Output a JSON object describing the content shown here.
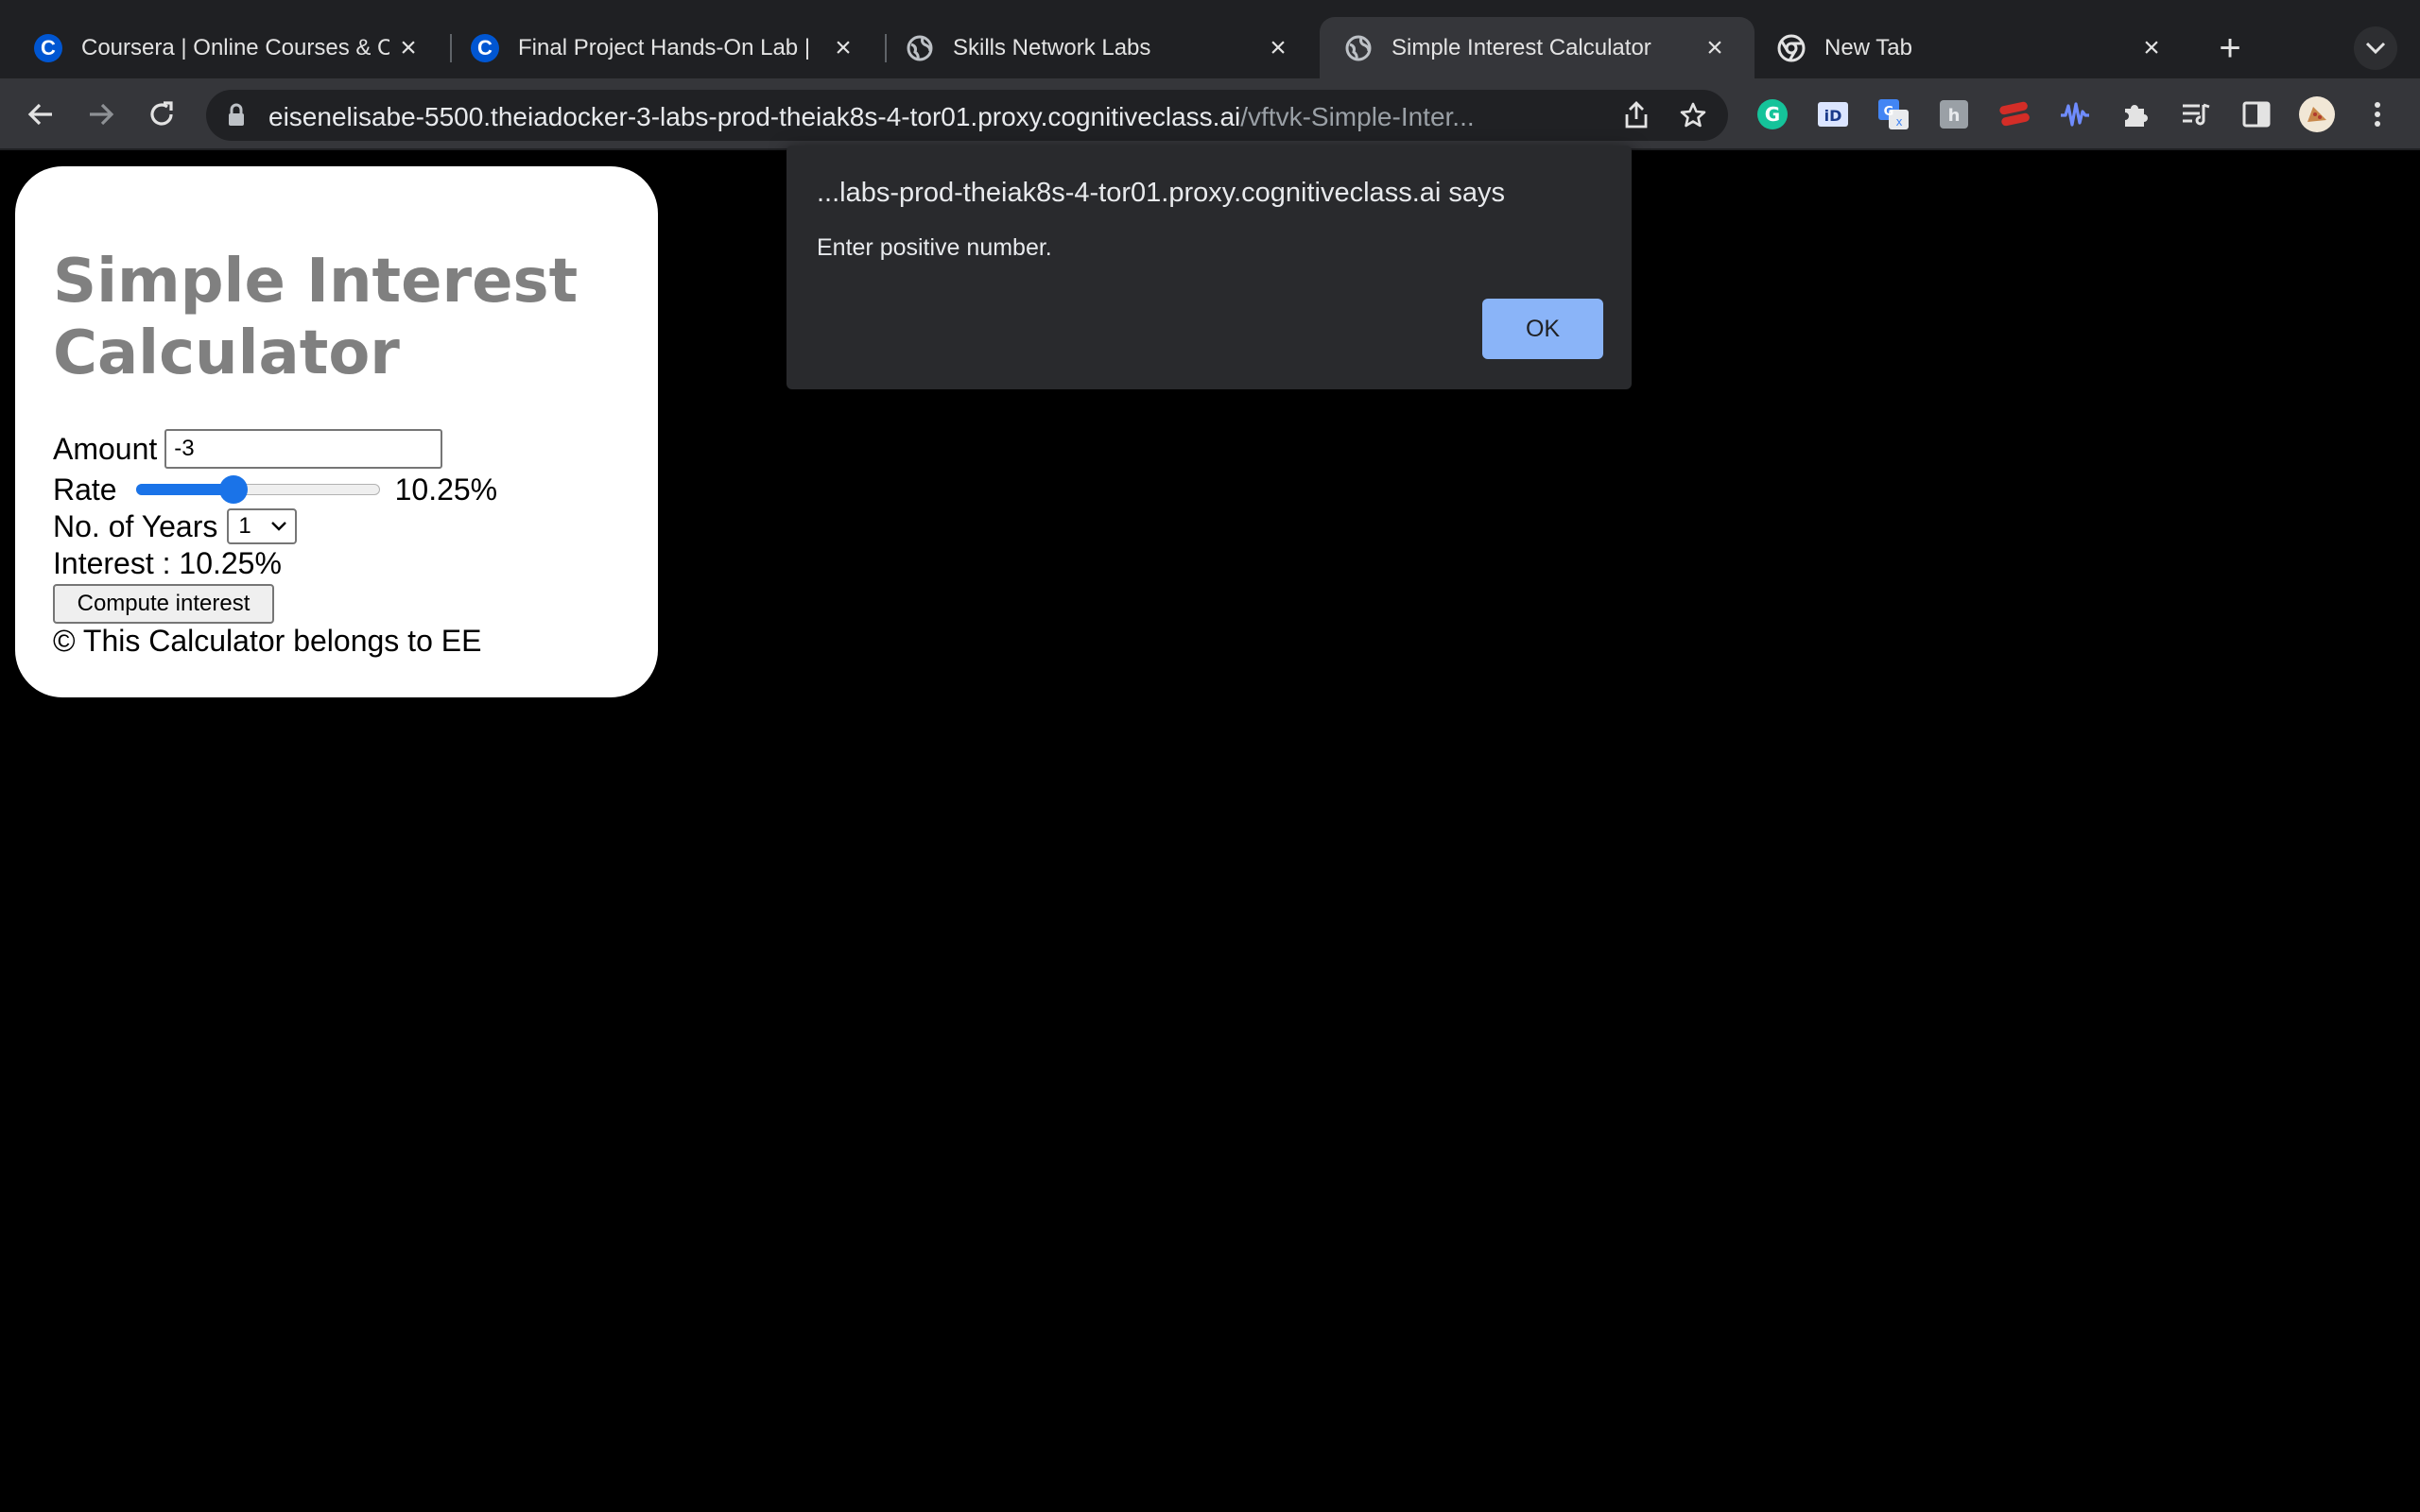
{
  "browser": {
    "tabs": [
      {
        "title": "Coursera | Online Courses & C",
        "icon": "coursera-icon"
      },
      {
        "title": "Final Project Hands-On Lab |",
        "icon": "coursera-icon"
      },
      {
        "title": "Skills Network Labs",
        "icon": "globe-icon"
      },
      {
        "title": "Simple Interest Calculator",
        "icon": "globe-icon",
        "active": true
      },
      {
        "title": "New Tab",
        "icon": "chrome-icon"
      }
    ],
    "url_host": "eisenelisabe-5500.theiadocker-3-labs-prod-theiak8s-4-tor01.proxy.cognitiveclass.ai",
    "url_path": "/vftvk-Simple-Inter...",
    "extensions": [
      "grammarly-icon",
      "id-icon",
      "google-translate-icon",
      "ext-box-icon",
      "lastpass-icon",
      "waveform-icon",
      "puzzle-icon",
      "reading-list-icon",
      "side-panel-icon",
      "profile-avatar"
    ]
  },
  "calculator": {
    "title": "Simple Interest Calculator",
    "amount_label": "Amount",
    "amount_value": "-3",
    "rate_label": "Rate",
    "rate_display": "10.25%",
    "rate_fraction": 0.4,
    "years_label": "No. of Years",
    "years_value": "1",
    "result_text": "Interest : 10.25%",
    "compute_label": "Compute interest",
    "footer": "© This Calculator belongs to EE"
  },
  "dialog": {
    "origin": "...labs-prod-theiak8s-4-tor01.proxy.cognitiveclass.ai says",
    "message": "Enter positive number.",
    "ok_label": "OK"
  },
  "colors": {
    "accent": "#1a73e8",
    "dialog_button": "#8ab4f8",
    "title_gray": "#808080"
  }
}
